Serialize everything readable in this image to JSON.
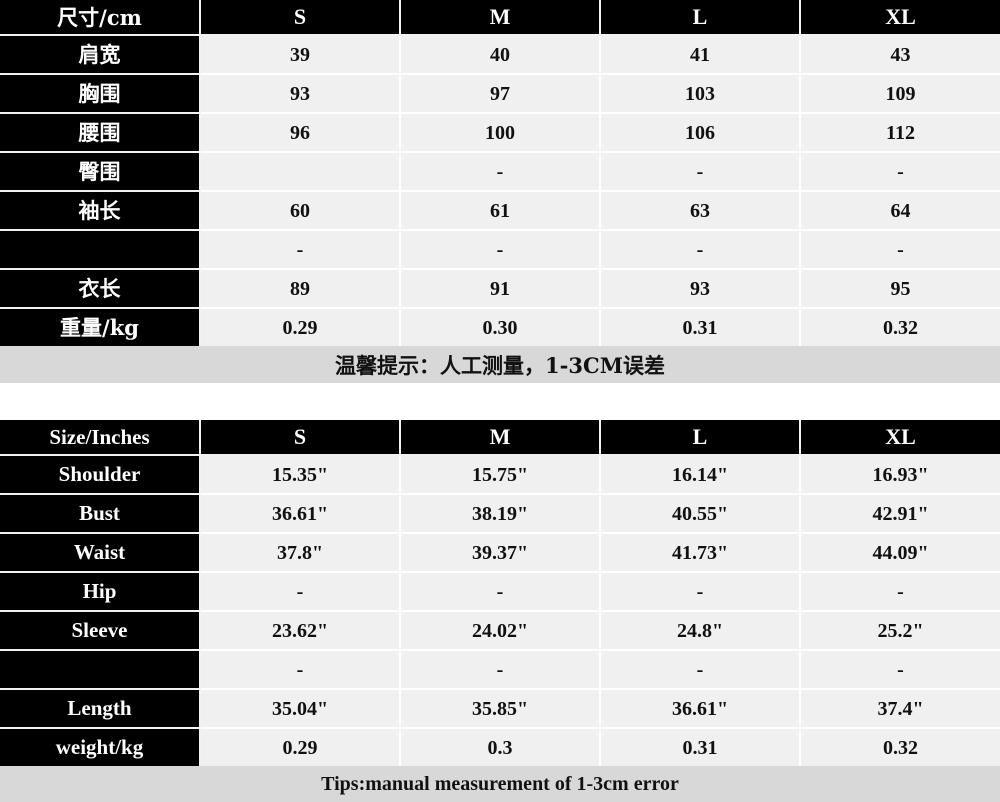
{
  "cm_table": {
    "header": [
      "尺寸/cm",
      "S",
      "M",
      "L",
      "XL"
    ],
    "rows": [
      {
        "label": "肩宽",
        "values": [
          "39",
          "40",
          "41",
          "43"
        ]
      },
      {
        "label": "胸围",
        "values": [
          "93",
          "97",
          "103",
          "109"
        ]
      },
      {
        "label": "腰围",
        "values": [
          "96",
          "100",
          "106",
          "112"
        ]
      },
      {
        "label": "臀围",
        "values": [
          "",
          "-",
          "-",
          "-"
        ]
      },
      {
        "label": "袖长",
        "values": [
          "60",
          "61",
          "63",
          "64"
        ]
      },
      {
        "label": "",
        "values": [
          "-",
          "-",
          "-",
          "-"
        ]
      },
      {
        "label": "衣长",
        "values": [
          "89",
          "91",
          "93",
          "95"
        ]
      },
      {
        "label": "重量/kg",
        "values": [
          "0.29",
          "0.30",
          "0.31",
          "0.32"
        ]
      }
    ],
    "tip": "温馨提示：人工测量，1-3CM误差"
  },
  "inch_table": {
    "header": [
      "Size/Inches",
      "S",
      "M",
      "L",
      "XL"
    ],
    "rows": [
      {
        "label": "Shoulder",
        "values": [
          "15.35\"",
          "15.75\"",
          "16.14\"",
          "16.93\""
        ]
      },
      {
        "label": "Bust",
        "values": [
          "36.61\"",
          "38.19\"",
          "40.55\"",
          "42.91\""
        ]
      },
      {
        "label": "Waist",
        "values": [
          "37.8\"",
          "39.37\"",
          "41.73\"",
          "44.09\""
        ]
      },
      {
        "label": "Hip",
        "values": [
          "-",
          "-",
          "-",
          "-"
        ]
      },
      {
        "label": "Sleeve",
        "values": [
          "23.62\"",
          "24.02\"",
          "24.8\"",
          "25.2\""
        ]
      },
      {
        "label": "",
        "values": [
          "-",
          "-",
          "-",
          "-"
        ]
      },
      {
        "label": "Length",
        "values": [
          "35.04\"",
          "35.85\"",
          "36.61\"",
          "37.4\""
        ]
      },
      {
        "label": "weight/kg",
        "values": [
          "0.29",
          "0.3",
          "0.31",
          "0.32"
        ]
      }
    ],
    "tip": "Tips:manual measurement of 1-3cm error"
  },
  "colors": {
    "header_bg": "#000000",
    "header_text": "#ffffff",
    "cell_bg": "#f0f0f0",
    "cell_text": "#111111",
    "tip_bg": "#d8d8d8",
    "page_bg": "#ffffff"
  }
}
